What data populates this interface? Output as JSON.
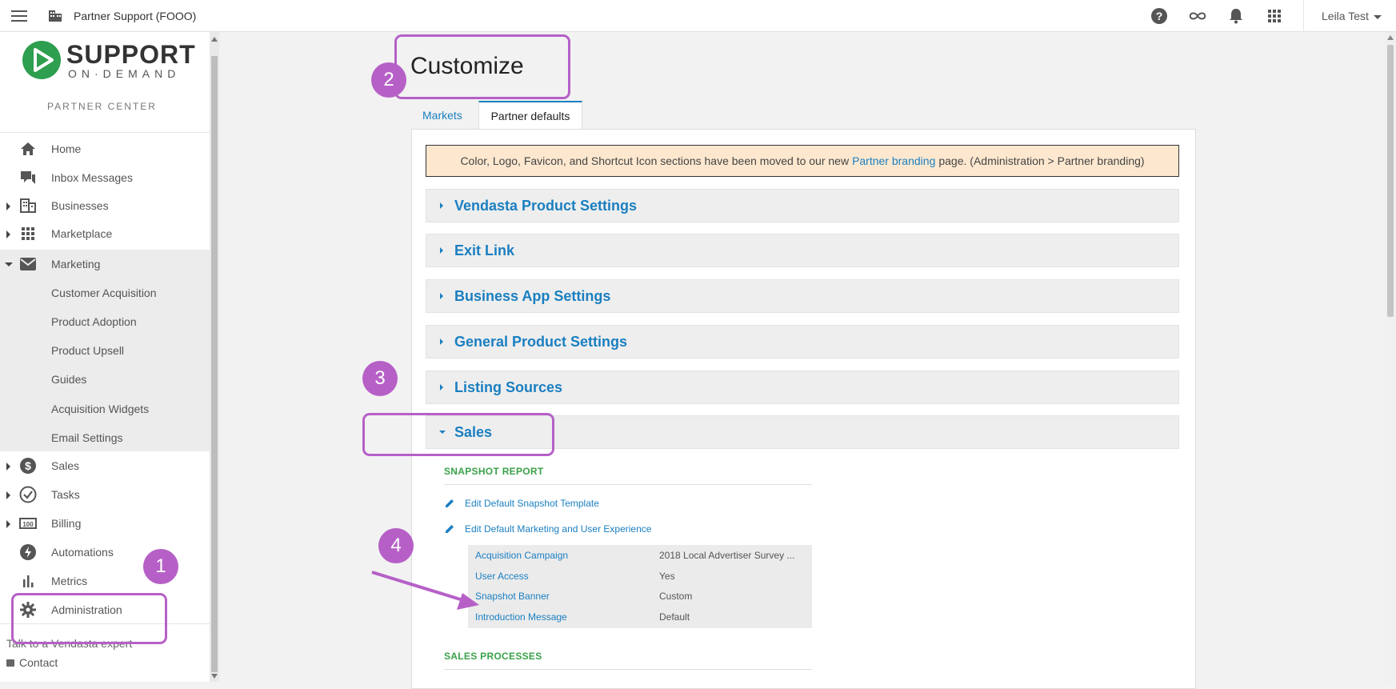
{
  "topbar": {
    "partner_name": "Partner Support (FOOO)",
    "user_name": "Leila Test"
  },
  "logo": {
    "line1": "SUPPORT",
    "line2": "ON·DEMAND",
    "subtitle": "PARTNER CENTER"
  },
  "sidebar": {
    "items": {
      "home": "Home",
      "inbox": "Inbox Messages",
      "businesses": "Businesses",
      "marketplace": "Marketplace",
      "marketing": "Marketing",
      "sales": "Sales",
      "tasks": "Tasks",
      "billing": "Billing",
      "automations": "Automations",
      "metrics": "Metrics",
      "administration": "Administration"
    },
    "marketing_sub": {
      "customer_acquisition": "Customer Acquisition",
      "product_adoption": "Product Adoption",
      "product_upsell": "Product Upsell",
      "guides": "Guides",
      "acquisition_widgets": "Acquisition Widgets",
      "email_settings": "Email Settings"
    },
    "talk": "Talk to a Vendasta expert",
    "contact": "Contact"
  },
  "main": {
    "title": "Customize",
    "tabs": {
      "markets": "Markets",
      "partner_defaults": "Partner defaults"
    },
    "notice": {
      "before": "Color, Logo, Favicon, and Shortcut Icon sections have been moved to our new",
      "link": "Partner branding",
      "after": "page. (Administration > Partner branding)"
    },
    "accordions": {
      "vendasta": "Vendasta Product Settings",
      "exit_link": "Exit Link",
      "business_app": "Business App Settings",
      "general": "General Product Settings",
      "listing": "Listing Sources",
      "sales": "Sales"
    },
    "snapshot": {
      "heading": "SNAPSHOT REPORT",
      "edit_template": "Edit Default Snapshot Template",
      "edit_marketing": "Edit Default Marketing and User Experience",
      "rows": [
        {
          "key": "Acquisition Campaign",
          "value": "2018 Local Advertiser Survey ..."
        },
        {
          "key": "User Access",
          "value": "Yes"
        },
        {
          "key": "Snapshot Banner",
          "value": "Custom"
        },
        {
          "key": "Introduction Message",
          "value": "Default"
        }
      ]
    },
    "sales_processes": {
      "heading": "SALES PROCESSES"
    }
  },
  "annotations": {
    "n1": "1",
    "n2": "2",
    "n3": "3",
    "n4": "4"
  },
  "colors": {
    "accent": "#1a7fc1",
    "annotation": "#b660c7",
    "section_heading": "#3aa14a",
    "notice_bg": "#fde8cf",
    "logo_green": "#2e9e4f"
  }
}
